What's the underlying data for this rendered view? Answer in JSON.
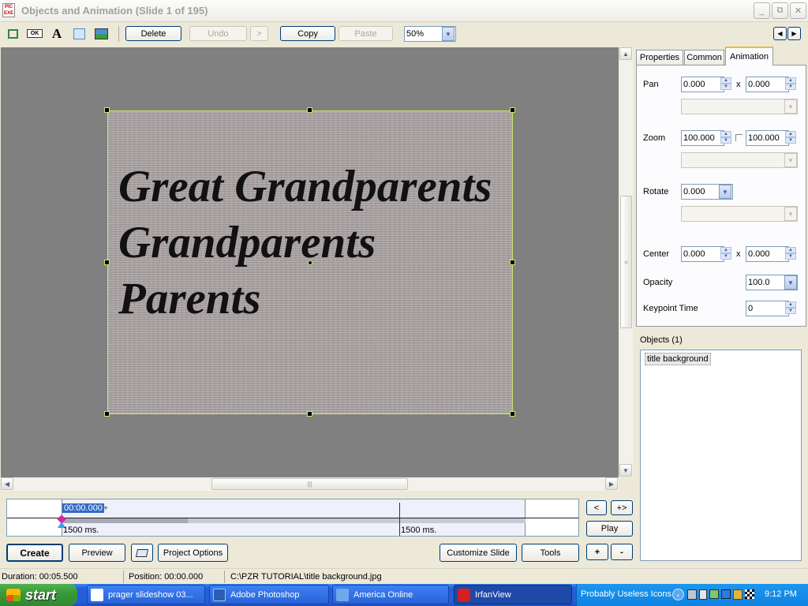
{
  "titlebar": {
    "title": "Objects and Animation  (Slide 1 of 195)",
    "min": "_",
    "max": "⧉",
    "close": "✕"
  },
  "toolbar": {
    "delete": "Delete",
    "undo": "Undo",
    "redo": ">",
    "copy": "Copy",
    "paste": "Paste",
    "zoom": "50%",
    "nav_prev": "◀",
    "nav_next": "▶"
  },
  "toolicons": [
    "rectangle-select-icon",
    "ok-button-icon",
    "text-icon",
    "shape-icon",
    "image-icon"
  ],
  "slide": {
    "lines": [
      "Great Grandparents",
      "Grandparents",
      "Parents"
    ]
  },
  "tabs": {
    "properties": "Properties",
    "common": "Common",
    "animation": "Animation"
  },
  "animation": {
    "pan_label": "Pan",
    "pan_x": "0.000",
    "pan_y": "0.000",
    "times": "x",
    "zoom_label": "Zoom",
    "zoom_x": "100.000",
    "zoom_y": "100.000",
    "rotate_label": "Rotate",
    "rotate": "0.000",
    "center_label": "Center",
    "center_x": "0.000",
    "center_y": "0.000",
    "opacity_label": "Opacity",
    "opacity": "100.0",
    "keypoint_label": "Keypoint Time",
    "keypoint": "0"
  },
  "objects": {
    "heading": "Objects (1)",
    "items": [
      "title background"
    ]
  },
  "timeline": {
    "time": "00:00.000",
    "plus": "+",
    "marker1": "1500 ms.",
    "marker2": "1500 ms.",
    "prev": "<",
    "add": "+>",
    "play": "Play"
  },
  "bottom": {
    "create": "Create",
    "preview": "Preview",
    "project_options": "Project Options",
    "customize": "Customize Slide",
    "tools": "Tools",
    "plus": "+",
    "minus": "-"
  },
  "status": {
    "duration": "Duration:  00:05.500",
    "position": "Position:  00:00.000",
    "file": "C:\\PZR TUTORIAL\\title background.jpg"
  },
  "taskbar": {
    "start": "start",
    "tasks": [
      "prager slideshow 03...",
      "Adobe Photoshop",
      "America  Online",
      "IrfanView"
    ],
    "tray_label": "Probably Useless Icons",
    "clock": "9:12 PM"
  },
  "colors": {
    "canvas": "#808080",
    "accent": "#2a63d8",
    "selection": "#c8e870"
  }
}
